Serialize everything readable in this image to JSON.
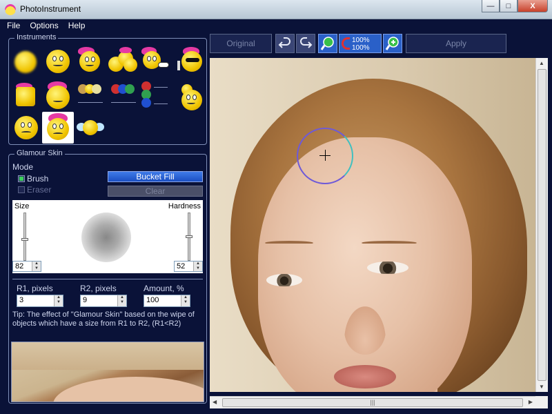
{
  "window": {
    "title": "PhotoInstrument"
  },
  "window_controls": {
    "minimize": "—",
    "maximize": "□",
    "close": "X"
  },
  "menu": {
    "items": [
      "File",
      "Options",
      "Help"
    ]
  },
  "instruments": {
    "title": "Instruments"
  },
  "glamour": {
    "title": "Glamour Skin",
    "mode_label": "Mode",
    "brush_label": "Brush",
    "eraser_label": "Eraser",
    "bucket_fill_label": "Bucket Fill",
    "clear_label": "Clear",
    "size_label": "Size",
    "hardness_label": "Hardness",
    "size_value": "82",
    "hardness_value": "52",
    "r1_label": "R1, pixels",
    "r2_label": "R2, pixels",
    "amount_label": "Amount, %",
    "r1_value": "3",
    "r2_value": "9",
    "amount_value": "100",
    "tip": "Tip: The effect of \"Glamour Skin\" based on the wipe of objects which have a size from R1 to R2, (R1<R2)"
  },
  "toolbar": {
    "original_label": "Original",
    "apply_label": "Apply",
    "zoom_top": "100%",
    "zoom_bottom": "100%"
  },
  "scroll": {
    "hthumb": "|||"
  },
  "icons": {
    "undo": "undo-icon",
    "redo": "redo-icon",
    "zoom_out": "zoom-out-icon",
    "zoom_fit": "zoom-fit-icon",
    "zoom_in": "zoom-in-icon"
  }
}
